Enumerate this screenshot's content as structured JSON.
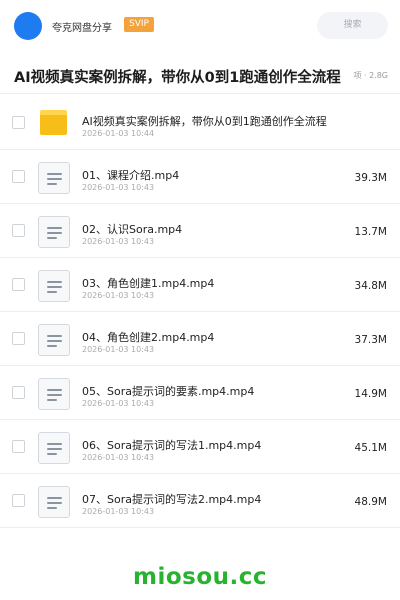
{
  "header": {
    "share_name": "夸克网盘分享",
    "badge": "SVIP",
    "search_placeholder": "搜索"
  },
  "title": {
    "text": "AI视频真实案例拆解，带你从0到1跑通创作全流程",
    "meta": "项 · 2.8G"
  },
  "files": [
    {
      "type": "folder",
      "name": "AI视频真实案例拆解，带你从0到1跑通创作全流程",
      "date": "2026-01-03 10:44",
      "size": ""
    },
    {
      "type": "file",
      "name": "01、课程介绍.mp4",
      "date": "2026-01-03 10:43",
      "size": "39.3M"
    },
    {
      "type": "file",
      "name": "02、认识Sora.mp4",
      "date": "2026-01-03 10:43",
      "size": "13.7M"
    },
    {
      "type": "file",
      "name": "03、角色创建1.mp4.mp4",
      "date": "2026-01-03 10:43",
      "size": "34.8M"
    },
    {
      "type": "file",
      "name": "04、角色创建2.mp4.mp4",
      "date": "2026-01-03 10:43",
      "size": "37.3M"
    },
    {
      "type": "file",
      "name": "05、Sora提示词的要素.mp4.mp4",
      "date": "2026-01-03 10:43",
      "size": "14.9M"
    },
    {
      "type": "file",
      "name": "06、Sora提示词的写法1.mp4.mp4",
      "date": "2026-01-03 10:43",
      "size": "45.1M"
    },
    {
      "type": "file",
      "name": "07、Sora提示词的写法2.mp4.mp4",
      "date": "2026-01-03 10:43",
      "size": "48.9M"
    }
  ],
  "watermark": "miosou.cc",
  "colors": {
    "avatar": "#1e7bf0",
    "svip_badge": "#f4a23c",
    "folder": "#f7bd18",
    "watermark": "#27b32e"
  }
}
